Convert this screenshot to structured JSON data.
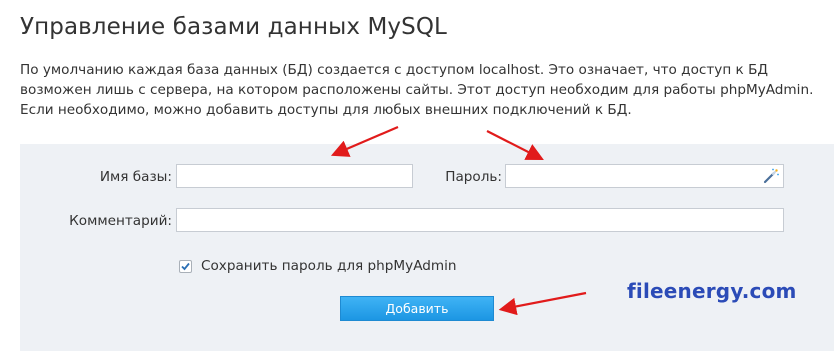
{
  "page": {
    "title": "Управление базами данных MySQL",
    "description": "По умолчанию каждая база данных (БД) создается с доступом localhost. Это означает, что доступ к БД возможен лишь с сервера, на котором расположены сайты. Этот доступ необходим для работы phpMyAdmin. Если необходимо, можно добавить доступы для любых внешних подключений к БД."
  },
  "form": {
    "db_name_label": "Имя базы:",
    "db_name_value": "",
    "password_label": "Пароль:",
    "password_value": "",
    "password_generate_icon": "magic-wand-icon",
    "comment_label": "Комментарий:",
    "comment_value": "",
    "save_password_label": "Сохранить пароль для phpMyAdmin",
    "save_password_checked": true,
    "submit_label": "Добавить"
  },
  "watermark": "fileenergy.com",
  "colors": {
    "panel_bg": "#eef1f5",
    "button_blue": "#1c96e3",
    "arrow_red": "#e11b1b",
    "watermark_blue": "#2b4bb7"
  }
}
